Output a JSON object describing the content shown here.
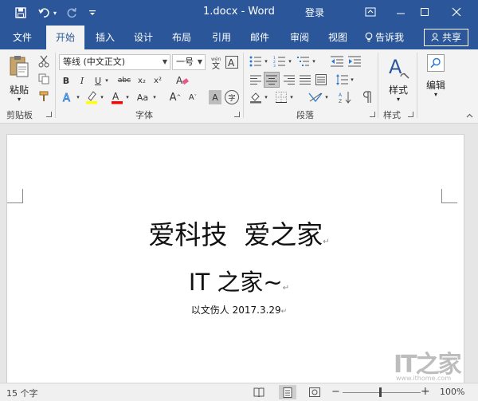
{
  "titlebar": {
    "document_title": "1.docx - Word",
    "login_label": "登录",
    "qa_icons": [
      "save-icon",
      "undo-icon",
      "redo-icon",
      "customize-icon"
    ],
    "window_icons": [
      "ribbon-options-icon",
      "minimize-icon",
      "maximize-icon",
      "close-icon"
    ]
  },
  "tabs": [
    {
      "label": "文件",
      "active": false
    },
    {
      "label": "开始",
      "active": true
    },
    {
      "label": "插入",
      "active": false
    },
    {
      "label": "设计",
      "active": false
    },
    {
      "label": "布局",
      "active": false
    },
    {
      "label": "引用",
      "active": false
    },
    {
      "label": "邮件",
      "active": false
    },
    {
      "label": "审阅",
      "active": false
    },
    {
      "label": "视图",
      "active": false
    }
  ],
  "tell_me": "告诉我",
  "share": "共享",
  "ribbon": {
    "clipboard": {
      "label": "剪贴板",
      "paste": "粘贴"
    },
    "font": {
      "label": "字体",
      "font_name": "等线 (中文正文)",
      "font_size": "一号",
      "bold": "B",
      "italic": "I",
      "underline": "U",
      "strike": "abc",
      "subscript": "x₂",
      "superscript": "x²",
      "case": "Aa",
      "grow": "A",
      "shrink": "A",
      "char_shading": "A",
      "enclose": "字"
    },
    "paragraph": {
      "label": "段落"
    },
    "styles": {
      "label": "样式",
      "button": "样式"
    },
    "editing": {
      "button": "编辑"
    }
  },
  "document": {
    "line1": "爱科技  爱之家",
    "line2": "IT 之家~",
    "line3": "以文伤人 2017.3.29",
    "para_mark": "↵"
  },
  "status": {
    "word_count": "15 个字",
    "zoom": "100%",
    "minus": "−",
    "plus": "+"
  },
  "watermark": {
    "logo": "IT之家",
    "url": "www.ithome.com"
  },
  "colors": {
    "brand": "#2b579a",
    "highlight": "#ffff00",
    "font_color": "#ff0000"
  }
}
